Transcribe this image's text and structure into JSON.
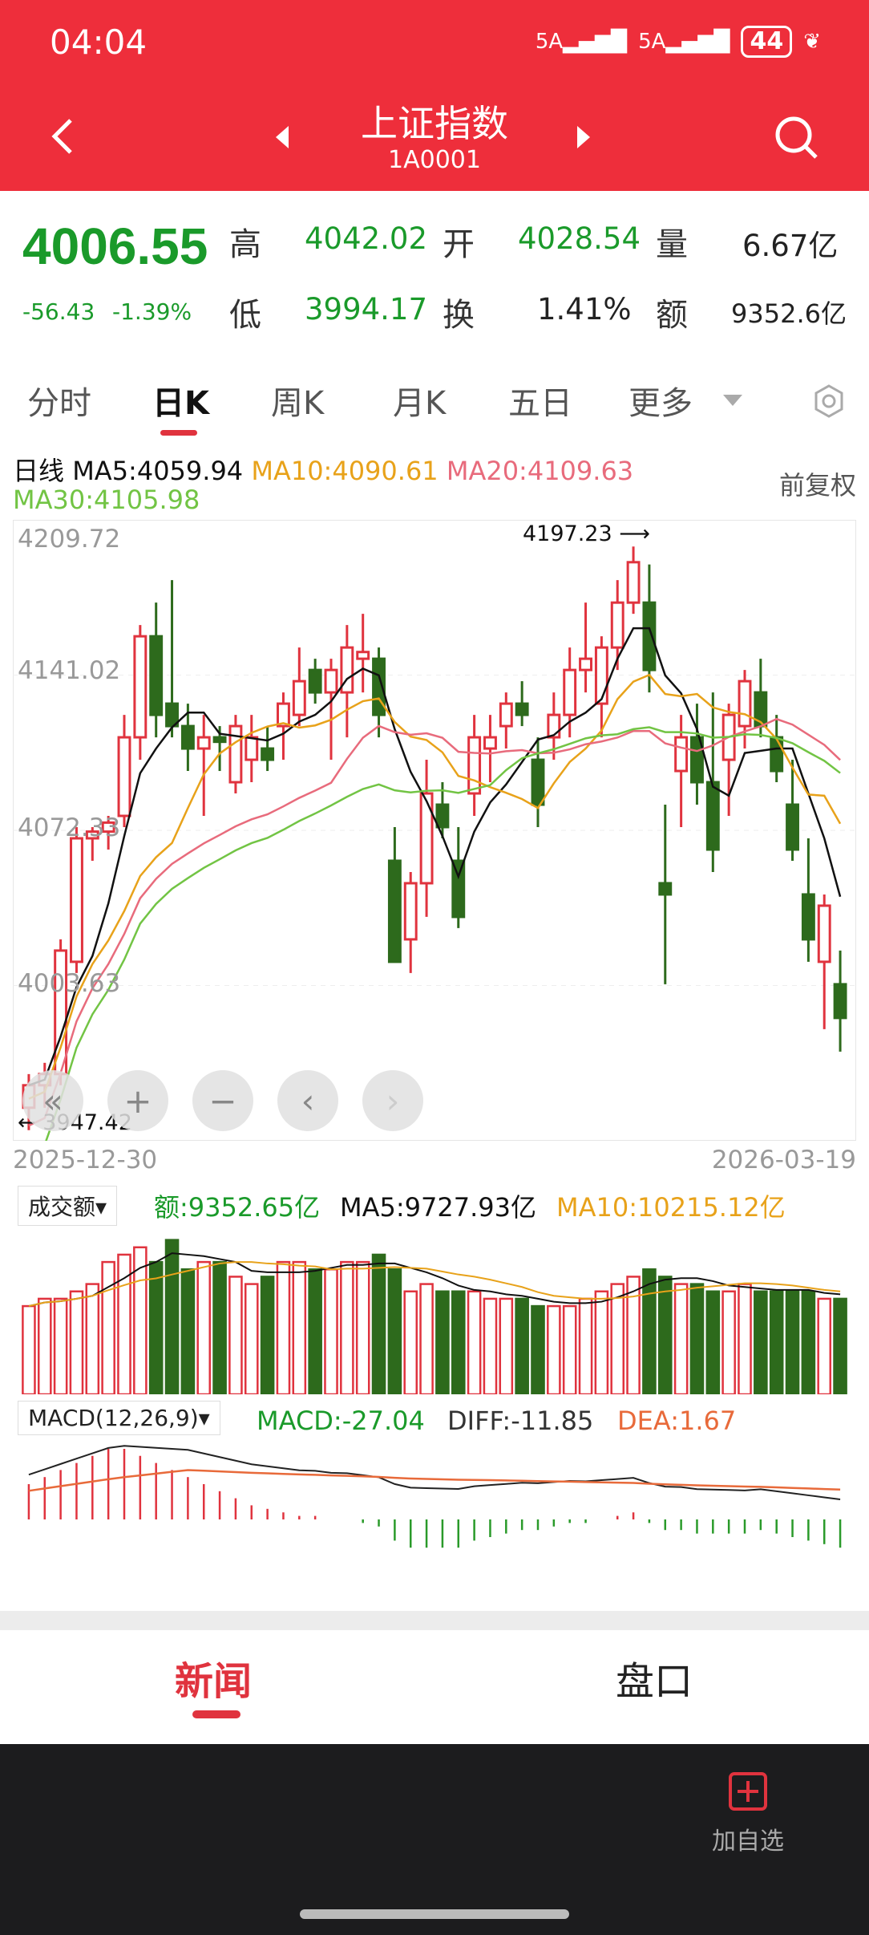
{
  "status": {
    "time": "04:04",
    "signal1": "5A",
    "signal2": "5A",
    "battery": "44"
  },
  "header": {
    "title": "上证指数",
    "code": "1A0001"
  },
  "quote": {
    "price": "4006.55",
    "change": "-56.43",
    "change_pct": "-1.39%",
    "high_label": "高",
    "high": "4042.02",
    "open_label": "开",
    "open": "4028.54",
    "vol_label": "量",
    "vol": "6.67亿",
    "low_label": "低",
    "low": "3994.17",
    "turnover_label": "换",
    "turnover": "1.41%",
    "amount_label": "额",
    "amount": "9352.6亿"
  },
  "tabs": [
    "分时",
    "日K",
    "周K",
    "月K",
    "五日",
    "更多"
  ],
  "kline": {
    "period": "日线",
    "ma5": "MA5:4059.94",
    "ma10": "MA10:4090.61",
    "ma20": "MA20:4109.63",
    "ma30": "MA30:4105.98",
    "adjust": "前复权",
    "y_ticks": [
      "4209.72",
      "4141.02",
      "4072.33",
      "4003.63"
    ],
    "max_label": "4197.23",
    "min_label": "3947.42",
    "start_date": "2025-12-30",
    "end_date": "2026-03-19"
  },
  "volume": {
    "selector": "成交额",
    "amount": "额:9352.65亿",
    "ma5": "MA5:9727.93亿",
    "ma10": "MA10:10215.12亿"
  },
  "macd": {
    "selector": "MACD(12,26,9)",
    "macd": "MACD:-27.04",
    "diff": "DIFF:-11.85",
    "dea": "DEA:1.67"
  },
  "bottom_tabs": {
    "news": "新闻",
    "book": "盘口"
  },
  "footer": {
    "add_watch": "加自选"
  },
  "colors": {
    "up": "#e0333e",
    "down": "#2d6a1c",
    "ma5": "#111111",
    "ma10": "#e8a21a",
    "ma20": "#e86b7c",
    "ma30": "#72c444"
  },
  "chart_data": {
    "type": "candlestick",
    "y_range": [
      3947.42,
      4209.72
    ],
    "ohlc": [
      [
        3955,
        3970,
        3945,
        3965
      ],
      [
        3965,
        3975,
        3955,
        3970
      ],
      [
        3970,
        4030,
        3965,
        4025
      ],
      [
        4020,
        4080,
        4015,
        4075
      ],
      [
        4075,
        4080,
        4065,
        4078
      ],
      [
        4078,
        4085,
        4070,
        4082
      ],
      [
        4085,
        4130,
        4080,
        4120
      ],
      [
        4120,
        4170,
        4110,
        4165
      ],
      [
        4165,
        4180,
        4120,
        4130
      ],
      [
        4135,
        4190,
        4120,
        4125
      ],
      [
        4125,
        4135,
        4105,
        4115
      ],
      [
        4115,
        4130,
        4085,
        4120
      ],
      [
        4120,
        4125,
        4105,
        4118
      ],
      [
        4100,
        4130,
        4095,
        4125
      ],
      [
        4110,
        4130,
        4100,
        4120
      ],
      [
        4115,
        4125,
        4105,
        4110
      ],
      [
        4125,
        4140,
        4110,
        4135
      ],
      [
        4130,
        4160,
        4125,
        4145
      ],
      [
        4150,
        4155,
        4135,
        4140
      ],
      [
        4140,
        4155,
        4110,
        4150
      ],
      [
        4140,
        4170,
        4120,
        4160
      ],
      [
        4155,
        4175,
        4140,
        4158
      ],
      [
        4155,
        4160,
        4120,
        4130
      ],
      [
        4065,
        4080,
        4020,
        4020
      ],
      [
        4030,
        4060,
        4015,
        4055
      ],
      [
        4055,
        4110,
        4040,
        4095
      ],
      [
        4090,
        4100,
        4075,
        4080
      ],
      [
        4065,
        4080,
        4035,
        4040
      ],
      [
        4095,
        4130,
        4085,
        4120
      ],
      [
        4115,
        4130,
        4100,
        4120
      ],
      [
        4125,
        4140,
        4115,
        4135
      ],
      [
        4135,
        4145,
        4125,
        4130
      ],
      [
        4110,
        4120,
        4080,
        4090
      ],
      [
        4120,
        4140,
        4110,
        4130
      ],
      [
        4130,
        4160,
        4120,
        4150
      ],
      [
        4150,
        4180,
        4140,
        4155
      ],
      [
        4135,
        4165,
        4120,
        4160
      ],
      [
        4160,
        4190,
        4150,
        4180
      ],
      [
        4180,
        4205,
        4175,
        4198
      ],
      [
        4180,
        4197,
        4140,
        4150
      ],
      [
        4055,
        4090,
        4010,
        4050
      ],
      [
        4105,
        4130,
        4080,
        4120
      ],
      [
        4120,
        4135,
        4090,
        4100
      ],
      [
        4100,
        4140,
        4060,
        4070
      ],
      [
        4110,
        4135,
        4085,
        4130
      ],
      [
        4125,
        4150,
        4115,
        4145
      ],
      [
        4140,
        4155,
        4120,
        4125
      ],
      [
        4120,
        4130,
        4100,
        4105
      ],
      [
        4090,
        4110,
        4065,
        4070
      ],
      [
        4050,
        4075,
        4020,
        4030
      ],
      [
        4020,
        4050,
        3990,
        4045
      ],
      [
        4010,
        4025,
        3980,
        3995
      ]
    ],
    "volume_series": [
      12,
      13,
      13,
      14,
      15,
      18,
      19,
      20,
      18,
      21,
      17,
      18,
      18,
      16,
      15,
      16,
      18,
      18,
      17,
      17,
      18,
      18,
      19,
      17,
      14,
      15,
      14,
      14,
      14,
      13,
      13,
      13,
      12,
      12,
      12,
      13,
      14,
      15,
      16,
      17,
      16,
      15,
      15,
      14,
      14,
      15,
      14,
      14,
      14,
      14,
      13,
      13
    ],
    "macd_histogram": [
      10,
      12,
      14,
      16,
      18,
      20,
      20,
      18,
      16,
      14,
      12,
      10,
      8,
      6,
      4,
      3,
      2,
      1,
      1,
      0,
      0,
      -1,
      -2,
      -6,
      -8,
      -8,
      -8,
      -8,
      -6,
      -5,
      -4,
      -3,
      -3,
      -2,
      -1,
      -1,
      0,
      1,
      2,
      -1,
      -3,
      -3,
      -4,
      -4,
      -4,
      -4,
      -3,
      -4,
      -5,
      -6,
      -7,
      -8
    ]
  }
}
